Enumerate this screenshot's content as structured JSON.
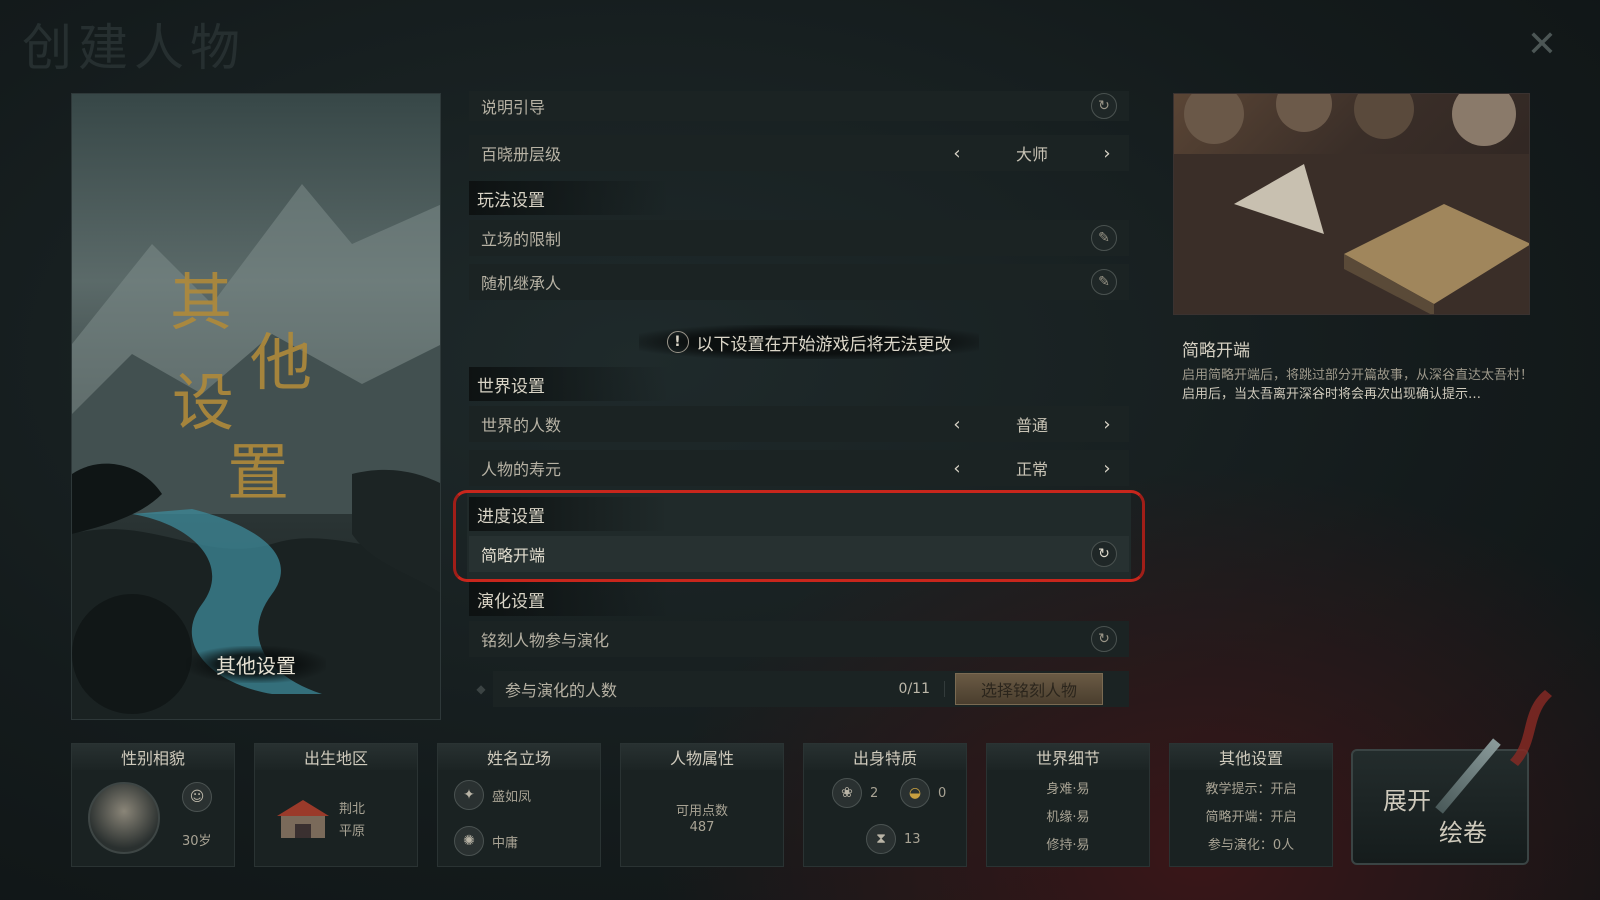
{
  "header": {
    "title": "创建人物"
  },
  "art": {
    "calligraphy": "其他设置",
    "caption": "其他设置"
  },
  "settings": {
    "guide_label": "说明引导",
    "codex": {
      "label": "百晓册层级",
      "value": "大师"
    },
    "sections": {
      "gameplay": "玩法设置",
      "world": "世界设置",
      "progress": "进度设置",
      "evolution": "演化设置"
    },
    "stance_limit": "立场的限制",
    "random_heir": "随机继承人",
    "warning": "以下设置在开始游戏后将无法更改",
    "world_population": {
      "label": "世界的人数",
      "value": "普通"
    },
    "lifespan": {
      "label": "人物的寿元",
      "value": "正常"
    },
    "brief_start": "简略开端",
    "engraved_evolve": "铭刻人物参与演化",
    "evolve_count": {
      "label": "参与演化的人数",
      "value": "0/11"
    },
    "choose_button": "选择铭刻人物"
  },
  "info": {
    "title": "简略开端",
    "desc1": "启用简略开端后，将跳过部分开篇故事，从深谷直达太吾村！",
    "desc2": "启用后，当太吾离开深谷时将会再次出现确认提示…"
  },
  "bottom": {
    "appearance": {
      "title": "性别相貌",
      "age": "30岁"
    },
    "birthplace": {
      "title": "出生地区",
      "line1": "荆北",
      "line2": "平原"
    },
    "name": {
      "title": "姓名立场",
      "name": "盛如凤",
      "stance": "中庸"
    },
    "attributes": {
      "title": "人物属性",
      "label": "可用点数",
      "points": "487"
    },
    "origin": {
      "title": "出身特质",
      "v1": "2",
      "v2": "0",
      "v3": "13"
    },
    "world": {
      "title": "世界细节",
      "l1": "身难·易",
      "l2": "机缘·易",
      "l3": "修持·易"
    },
    "other": {
      "title": "其他设置",
      "l1": "教学提示：开启",
      "l2": "简略开端：开启",
      "l3": "参与演化：0人"
    },
    "expand": {
      "l1": "展开",
      "l2": "绘卷"
    }
  },
  "colors": {
    "highlight": "#c8261c",
    "background": "#141b1c",
    "button_gold": "#6a5a44"
  }
}
